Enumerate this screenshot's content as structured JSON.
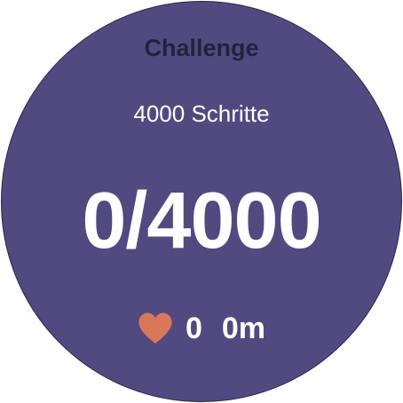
{
  "colors": {
    "face_background": "#514a81",
    "title_text": "#24213b",
    "body_text": "#ffffff",
    "heart": "#d9775b"
  },
  "title": "Challenge",
  "subtitle": "4000 Schritte",
  "progress": "0/4000",
  "stats": {
    "heart_icon": "heart-icon",
    "heart_rate": "0",
    "distance": "0m"
  }
}
